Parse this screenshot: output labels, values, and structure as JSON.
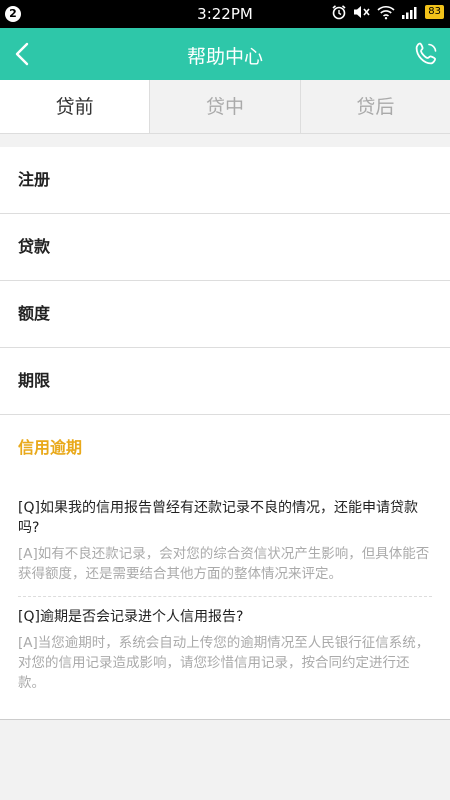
{
  "status": {
    "notification_count": "2",
    "time": "3:22PM",
    "battery": "83"
  },
  "nav": {
    "title": "帮助中心"
  },
  "tabs": [
    {
      "label": "贷前"
    },
    {
      "label": "贷中"
    },
    {
      "label": "贷后"
    }
  ],
  "categories": [
    {
      "label": "注册"
    },
    {
      "label": "贷款"
    },
    {
      "label": "额度"
    },
    {
      "label": "期限"
    },
    {
      "label": "信用逾期"
    }
  ],
  "faq": [
    {
      "question": "[Q]如果我的信用报告曾经有还款记录不良的情况，还能申请贷款吗?",
      "answer": "[A]如有不良还款记录，会对您的综合资信状况产生影响，但具体能否获得额度，还是需要结合其他方面的整体情况来评定。"
    },
    {
      "question": "[Q]逾期是否会记录进个人信用报告?",
      "answer": "[A]当您逾期时，系统会自动上传您的逾期情况至人民银行征信系统，对您的信用记录造成影响，请您珍惜信用记录，按合同约定进行还款。"
    }
  ],
  "colors": {
    "accent": "#2ec7a9",
    "highlight": "#e9a91a"
  },
  "icons": [
    "back-arrow-icon",
    "phone-icon",
    "alarm-icon",
    "mute-icon",
    "wifi-icon",
    "signal-icon",
    "battery-icon"
  ]
}
